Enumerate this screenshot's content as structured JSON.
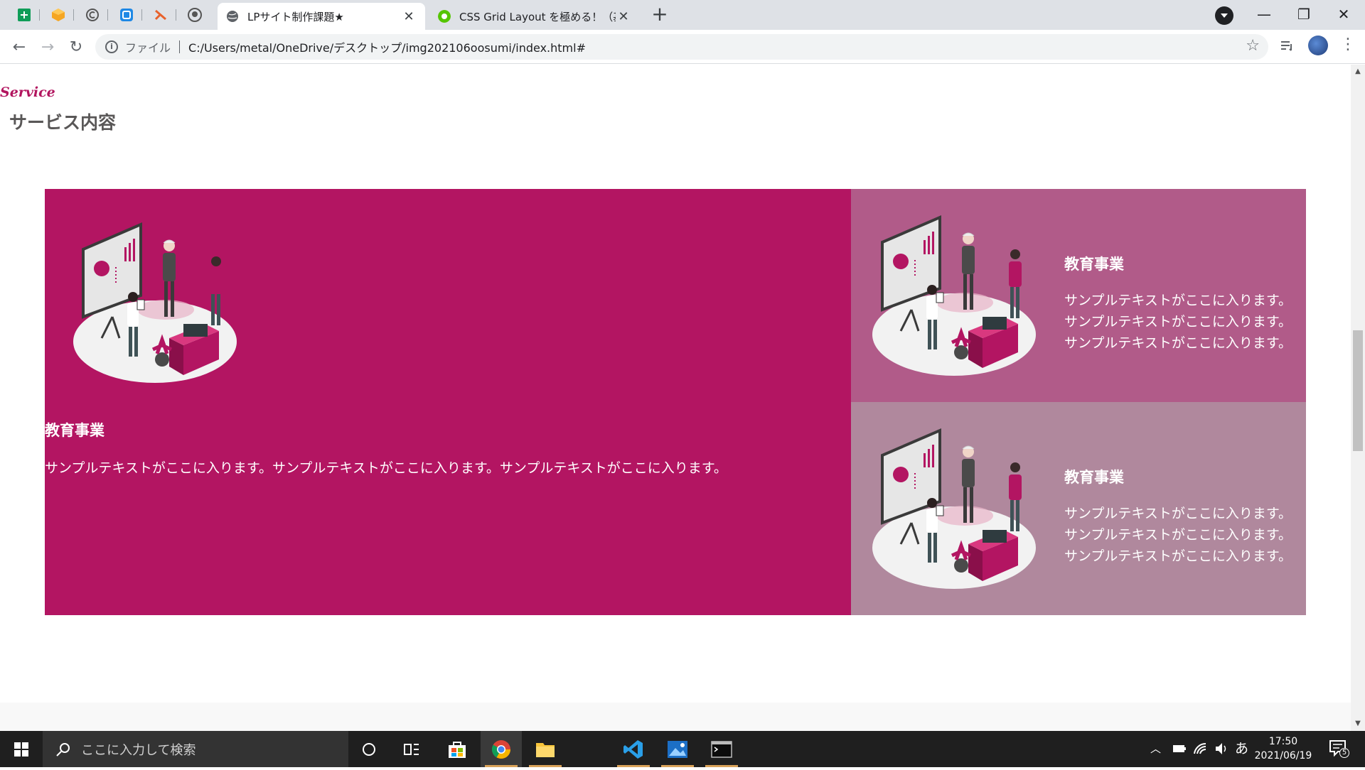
{
  "browser": {
    "tabs": [
      {
        "title": "LPサイト制作課題★",
        "active": true
      },
      {
        "title": "CSS Grid Layout を極める！（基礎",
        "active": false
      }
    ],
    "new_tab_label": "+",
    "close_glyph": "✕",
    "window_controls": {
      "minimize": "—",
      "maximize": "❐",
      "close": "✕"
    },
    "nav": {
      "back": "←",
      "forward": "→",
      "reload": "↻"
    },
    "address": {
      "scheme_label": "ファイル",
      "url": "C:/Users/metal/OneDrive/デスクトップ/img202106oosumi/index.html#"
    },
    "bookmark_glyph": "☆"
  },
  "page": {
    "service_en": "Service",
    "service_jp": "サービス内容",
    "main": {
      "heading": "教育事業",
      "text": "サンプルテキストがここに入ります。サンプルテキストがここに入ります。サンプルテキストがここに入ります。"
    },
    "side_items": [
      {
        "heading": "教育事業",
        "lines": [
          "サンプルテキストがここに入ります。",
          "サンプルテキストがここに入ります。",
          "サンプルテキストがここに入ります。"
        ]
      },
      {
        "heading": "教育事業",
        "lines": [
          "サンプルテキストがここに入ります。",
          "サンプルテキストがここに入ります。",
          "サンプルテキストがここに入ります。"
        ]
      }
    ],
    "colors": {
      "main": "#b31562",
      "side1": "#b15b89",
      "side2": "#b0889d",
      "accent": "#b2155f"
    }
  },
  "taskbar": {
    "search_placeholder": "ここに入力して検索",
    "ime": "あ",
    "time": "17:50",
    "date": "2021/06/19",
    "notification_count": "5"
  }
}
